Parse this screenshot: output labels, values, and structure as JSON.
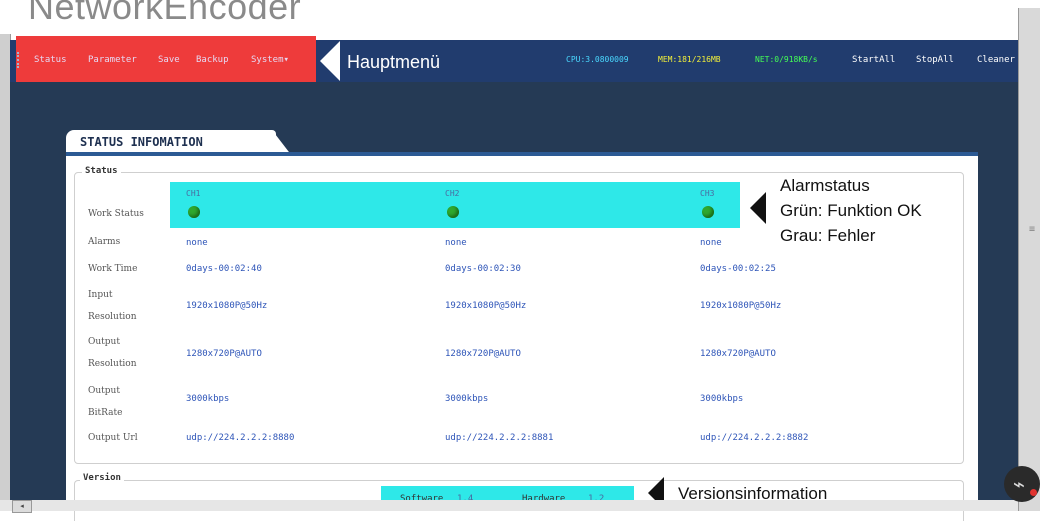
{
  "app": {
    "title": "NetworkEncoder"
  },
  "menu": {
    "items": [
      "Status",
      "Parameter",
      "Save",
      "Backup",
      "System"
    ],
    "system_caret": "▾"
  },
  "annotations": {
    "hauptmenu": "Hauptmenü",
    "alarm_title": "Alarmstatus",
    "alarm_green": "Grün: Funktion OK",
    "alarm_grey": "Grau: Fehler",
    "version": "Versionsinformation"
  },
  "stats": {
    "cpu": "CPU:3.0800009",
    "mem": "MEM:181/216MB",
    "net": "NET:0/918KB/s"
  },
  "actions": [
    "StartAll",
    "StopAll",
    "Cleaner"
  ],
  "colors": {
    "navbar": "#213c6e",
    "menu_highlight": "#ee3b3b",
    "cyan_highlight": "#2ee8e8",
    "led_green": "#2fa82f",
    "value_blue": "#2e55b8",
    "cpu_text": "#4ad8ff",
    "mem_text": "#f2ef3a",
    "net_text": "#44ff55"
  },
  "tab": {
    "label": "STATUS INFOMATION"
  },
  "status": {
    "legend": "Status",
    "channels": [
      "CH1",
      "CH2",
      "CH3"
    ],
    "rows": [
      {
        "label": "Work Status",
        "values": [
          "",
          "",
          ""
        ]
      },
      {
        "label": "Alarms",
        "values": [
          "none",
          "none",
          "none"
        ]
      },
      {
        "label": "Work Time",
        "values": [
          "0days-00:02:40",
          "0days-00:02:30",
          "0days-00:02:25"
        ]
      },
      {
        "label": "Input",
        "label2": "Resolution",
        "values": [
          "1920x1080P@50Hz",
          "1920x1080P@50Hz",
          "1920x1080P@50Hz"
        ]
      },
      {
        "label": "Output",
        "label2": "Resolution",
        "values": [
          "1280x720P@AUTO",
          "1280x720P@AUTO",
          "1280x720P@AUTO"
        ]
      },
      {
        "label": "Output",
        "label2": "BitRate",
        "values": [
          "3000kbps",
          "3000kbps",
          "3000kbps"
        ]
      },
      {
        "label": "Output Url",
        "values": [
          "udp://224.2.2.2:8880",
          "udp://224.2.2.2:8881",
          "udp://224.2.2.2:8882"
        ]
      }
    ]
  },
  "version": {
    "legend": "Version",
    "software_label": "Software",
    "software_value": "1.4",
    "hardware_label": "Hardware",
    "hardware_value": "1.2"
  },
  "scrollbar": {
    "left_arrow": "◂"
  },
  "wifi": {
    "icon": "wifi-icon"
  }
}
